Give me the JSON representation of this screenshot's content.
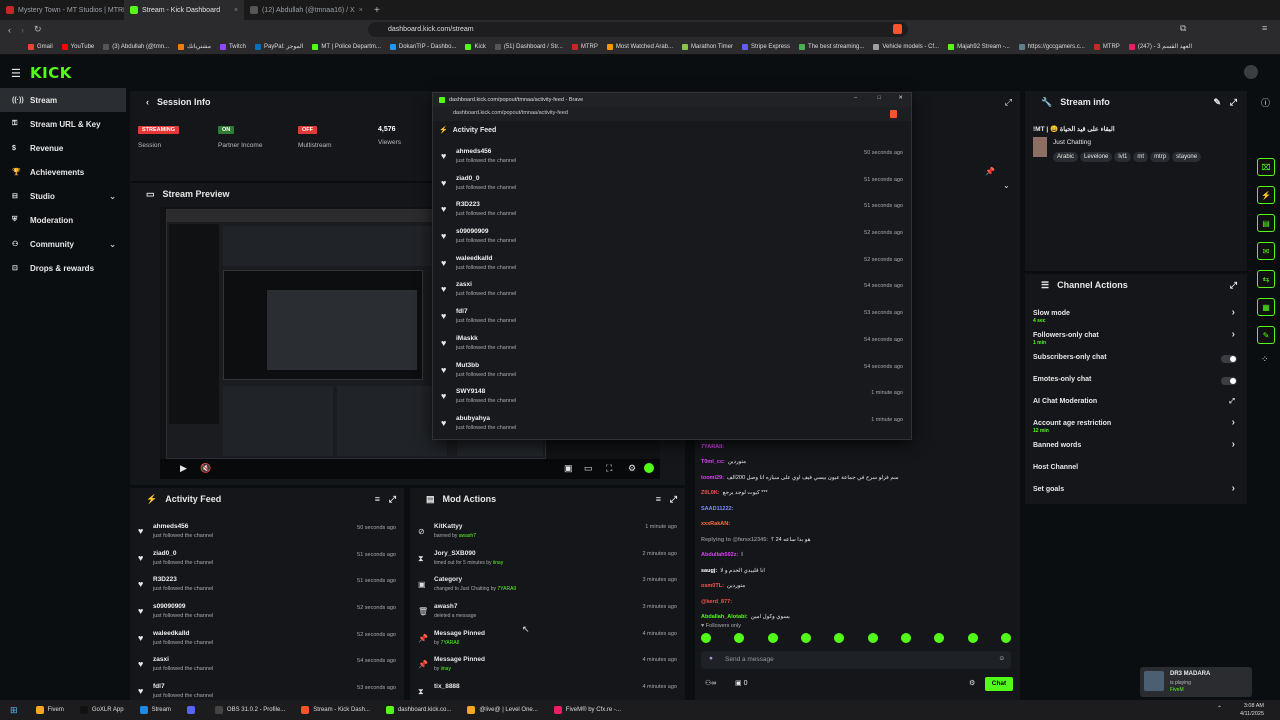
{
  "browser": {
    "tabs": [
      {
        "title": "Mystery Town - MT Studios | MTRP |",
        "color": "#c62828",
        "active": false
      },
      {
        "title": "Stream - Kick Dashboard",
        "color": "#53fc18",
        "active": true
      },
      {
        "title": "(12) Abdullah (@tmnaa16) / X",
        "color": "#555555",
        "active": false
      }
    ],
    "new_tab": "+",
    "url": "dashboard.kick.com/stream",
    "bookmarks": [
      {
        "label": "Gmail",
        "color": "#ea4335"
      },
      {
        "label": "YouTube",
        "color": "#ff0000"
      },
      {
        "label": "(3) Abdullah (@tmn...",
        "color": "#555555"
      },
      {
        "label": "مشترياتك",
        "color": "#f57c00"
      },
      {
        "label": "Twitch",
        "color": "#9146ff"
      },
      {
        "label": "PayPal: الموجز",
        "color": "#0070ba"
      },
      {
        "label": "MT | Police Departm...",
        "color": "#53fc18"
      },
      {
        "label": "DokanTIP - Dashbo...",
        "color": "#2196f3"
      },
      {
        "label": "Kick",
        "color": "#53fc18"
      },
      {
        "label": "(51) Dashboard / Str...",
        "color": "#555555"
      },
      {
        "label": "MTRP",
        "color": "#c62828"
      },
      {
        "label": "Most Watched Arab...",
        "color": "#ff9800"
      },
      {
        "label": "Marathon Timer",
        "color": "#8bc34a"
      },
      {
        "label": "Stripe Express",
        "color": "#635bff"
      },
      {
        "label": "The best streaming...",
        "color": "#4caf50"
      },
      {
        "label": "Vehicle models - Cf...",
        "color": "#9e9e9e"
      },
      {
        "label": "Majah92 Stream -...",
        "color": "#53fc18"
      },
      {
        "label": "https://gccgamers.c...",
        "color": "#607d8b"
      },
      {
        "label": "MTRP",
        "color": "#c62828"
      },
      {
        "label": "العهد القسم 3 - (247)",
        "color": "#e91e63"
      }
    ]
  },
  "app": {
    "logo": "KICK",
    "sidebar": [
      {
        "label": "Stream",
        "icon": "broadcast-icon",
        "active": true,
        "chevron": false
      },
      {
        "label": "Stream URL & Key",
        "icon": "key-icon",
        "active": false,
        "chevron": false
      },
      {
        "label": "Revenue",
        "icon": "dollar-icon",
        "active": false,
        "chevron": false
      },
      {
        "label": "Achievements",
        "icon": "trophy-icon",
        "active": false,
        "chevron": false
      },
      {
        "label": "Studio",
        "icon": "studio-icon",
        "active": false,
        "chevron": true
      },
      {
        "label": "Moderation",
        "icon": "shield-icon",
        "active": false,
        "chevron": false
      },
      {
        "label": "Community",
        "icon": "people-icon",
        "active": false,
        "chevron": true
      },
      {
        "label": "Drops & rewards",
        "icon": "gift-icon",
        "active": false,
        "chevron": false
      }
    ]
  },
  "session": {
    "title": "Session Info",
    "stats": [
      {
        "badge": "STREAMING",
        "badge_color": "#e53935",
        "label": "Session"
      },
      {
        "badge": "ON",
        "badge_color": "#2e7d32",
        "label": "Partner Income"
      },
      {
        "badge": "OFF",
        "badge_color": "#e53935",
        "label": "Multistream"
      },
      {
        "badge": "4,576",
        "badge_color": "",
        "label": "Viewers"
      }
    ]
  },
  "preview": {
    "title": "Stream Preview"
  },
  "feed": [
    {
      "name": "ahmeds456",
      "sub": "just followed the channel",
      "time": "50 seconds ago"
    },
    {
      "name": "ziad0_0",
      "sub": "just followed the channel",
      "time": "51 seconds ago"
    },
    {
      "name": "R3D223",
      "sub": "just followed the channel",
      "time": "51 seconds ago"
    },
    {
      "name": "s09090909",
      "sub": "just followed the channel",
      "time": "52 seconds ago"
    },
    {
      "name": "waleedkalld",
      "sub": "just followed the channel",
      "time": "52 seconds ago"
    },
    {
      "name": "zasxi",
      "sub": "just followed the channel",
      "time": "54 seconds ago"
    },
    {
      "name": "fdl7",
      "sub": "just followed the channel",
      "time": "53 seconds ago"
    },
    {
      "name": "iMaskk",
      "sub": "just followed the channel",
      "time": "54 seconds ago"
    },
    {
      "name": "Mut3bb",
      "sub": "just followed the channel",
      "time": "54 seconds ago"
    },
    {
      "name": "SWY9148",
      "sub": "just followed the channel",
      "time": "1 minute ago"
    },
    {
      "name": "abubyahya",
      "sub": "just followed the channel",
      "time": "1 minute ago"
    }
  ],
  "activity_panel": {
    "title": "Activity Feed"
  },
  "mod_actions": {
    "title": "Mod Actions",
    "rows": [
      {
        "icon": "ban-icon",
        "name": "KitKattyy",
        "sub1": "banned by ",
        "sub2": "awash7",
        "time": "1 minute ago"
      },
      {
        "icon": "timeout-icon",
        "name": "Jory_SXB090",
        "sub1": "timed out for 5 minutes by ",
        "sub2": "iinay",
        "time": "2 minutes ago"
      },
      {
        "icon": "category-icon",
        "name": "Category",
        "sub1": "changed to Just Chatting by ",
        "sub2": "7YARAII",
        "time": "3 minutes ago"
      },
      {
        "icon": "trash-icon",
        "name": "awash7",
        "sub1": "deleted a message",
        "sub2": "",
        "time": "3 minutes ago"
      },
      {
        "icon": "pin-icon",
        "name": "Message Pinned",
        "sub1": "by ",
        "sub2": "7YARAII",
        "time": "4 minutes ago"
      },
      {
        "icon": "pin-icon",
        "name": "Message Pinned",
        "sub1": "by ",
        "sub2": "iinay",
        "time": "4 minutes ago"
      },
      {
        "icon": "timeout-icon",
        "name": "tix_8888",
        "sub1": "",
        "sub2": "",
        "time": "4 minutes ago"
      }
    ]
  },
  "popup": {
    "title": "dashboard.kick.com/popout/tmnaa/activity-feed - Brave",
    "url": "dashboard.kick.com/popout/tmnaa/activity-feed",
    "heading": "Activity Feed"
  },
  "stream_info": {
    "title": "Stream info",
    "stream_title": "!MT | 😄 البقاء على قيد الحياة",
    "category": "Just Chatting",
    "tags": [
      "Arabic",
      "Levelone",
      "lvl1",
      "mt",
      "mtrp",
      "stayone"
    ]
  },
  "channel_actions": {
    "title": "Channel Actions",
    "items": [
      {
        "label": "Slow mode",
        "sub": "4 sec",
        "control": "chevron"
      },
      {
        "label": "Followers-only chat",
        "sub": "1 min",
        "control": "chevron"
      },
      {
        "label": "Subscribers-only chat",
        "sub": "",
        "control": "toggle"
      },
      {
        "label": "Emotes-only chat",
        "sub": "",
        "control": "toggle"
      },
      {
        "label": "AI Chat Moderation",
        "sub": "",
        "control": "external"
      },
      {
        "label": "Account age restriction",
        "sub": "12 min",
        "control": "chevron"
      },
      {
        "label": "Banned words",
        "sub": "",
        "control": "chevron"
      },
      {
        "label": "Host Channel",
        "sub": "",
        "control": "none"
      },
      {
        "label": "Set goals",
        "sub": "",
        "control": "chevron"
      }
    ]
  },
  "chat": {
    "lines": [
      {
        "user": "7YARAII:",
        "color": "#e040fb",
        "text": ""
      },
      {
        "user": "T0ml_cc:",
        "color": "#e040fb",
        "text": "متوردين"
      },
      {
        "user": "toomi29:",
        "color": "#e040fb",
        "text": "سم فزلو سرح في جماعة عيون بيسي فيف اوي على سياره انا وصل 200الف"
      },
      {
        "user": "Z0L0K:",
        "color": "#ff5252",
        "text": "كيوت لوجد يرجع ***"
      },
      {
        "user": "SAAD11222:",
        "color": "#7c8cff",
        "text": ""
      },
      {
        "user": "xxxRakAN:",
        "color": "#ff7043",
        "text": ""
      },
      {
        "user": "Replying to @farsx12345:",
        "color": "#888888",
        "text": "هو بدا ساعه 24 ؟"
      },
      {
        "user": "Abdullah502z:",
        "color": "#e040fb",
        "text": "ا"
      },
      {
        "user": "saugj:",
        "color": "#ffffff",
        "text": "انا قلبيدي الخدم و لا"
      },
      {
        "user": "osm0TL:",
        "color": "#ff5252",
        "text": "متوردين"
      },
      {
        "user": "@kerd_877:",
        "color": "#ff5252",
        "text": ""
      },
      {
        "user": "Abdallah_Alotabi:",
        "color": "#53fc18",
        "text": "يسوي وكول امين"
      }
    ],
    "followers_only": "Followers only",
    "placeholder": "Send a message",
    "count": "0",
    "chat_button": "Chat"
  },
  "notification": {
    "title": "DR3 MADARA",
    "sub1": "is playing",
    "sub2": "FiveM"
  },
  "taskbar": {
    "items": [
      {
        "label": "Fivem",
        "color": "#f5a623"
      },
      {
        "label": "GoXLR App",
        "color": "#111111"
      },
      {
        "label": "Stream",
        "color": "#1e88e5"
      },
      {
        "label": "",
        "color": "#5865f2"
      },
      {
        "label": "OBS 31.0.2 - Profile...",
        "color": "#444444"
      },
      {
        "label": "Stream - Kick Dash...",
        "color": "#fb542b"
      },
      {
        "label": "dashboard.kick.co...",
        "color": "#53fc18"
      },
      {
        "label": "@live@ | Level One...",
        "color": "#f5a623"
      },
      {
        "label": "FiveM® by Cfx.re -...",
        "color": "#e91e63"
      }
    ],
    "time": "3:08 AM",
    "date": "4/11/2025"
  }
}
